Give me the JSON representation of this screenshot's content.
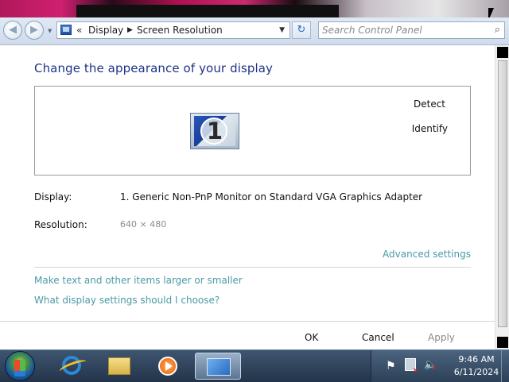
{
  "address_bar": {
    "breadcrumb_chevron": "«",
    "crumb_1": "Display",
    "crumb_2": "Screen Resolution",
    "arrow_glyph": "▶",
    "dropdown_glyph": "▼",
    "refresh_glyph": "↻"
  },
  "navigation": {
    "back_glyph": "◀",
    "forward_glyph": "▶",
    "history_dropdown_glyph": "▼"
  },
  "search": {
    "placeholder": "Search Control Panel",
    "icon_glyph": "⌕"
  },
  "main": {
    "title": "Change the appearance of your display",
    "monitor_number": "1",
    "detect_label": "Detect",
    "identify_label": "Identify",
    "display_label": "Display:",
    "display_value": "1. Generic Non-PnP Monitor on Standard VGA Graphics Adapter",
    "resolution_label": "Resolution:",
    "resolution_value": "640 × 480",
    "advanced_settings_label": "Advanced settings",
    "link_text_size": "Make text and other items larger or smaller",
    "link_display_settings": "What display settings should I choose?"
  },
  "footer": {
    "ok_label": "OK",
    "cancel_label": "Cancel",
    "apply_label": "Apply"
  },
  "taskbar": {
    "clock_time": "9:46 AM",
    "clock_date": "6/11/2024",
    "tray_flag_glyph": "⚑",
    "tray_volume_glyph": "🔈",
    "tray_volume_muted_glyph": "✕"
  },
  "colors": {
    "title_blue": "#1e3287",
    "link_teal": "#4a9aa6",
    "disabled_gray": "#8a8a8a",
    "taskbar_top": "#3f5570",
    "taskbar_bottom": "#23344a"
  },
  "icons": {
    "start_button": "windows-start-orb-icon",
    "ie": "internet-explorer-icon",
    "explorer": "windows-explorer-folder-icon",
    "media": "media-player-icon",
    "display_app": "display-settings-icon",
    "address_root": "control-panel-icon",
    "search": "search-icon",
    "flag": "action-center-flag-icon",
    "network": "network-icon",
    "volume": "volume-muted-icon"
  }
}
